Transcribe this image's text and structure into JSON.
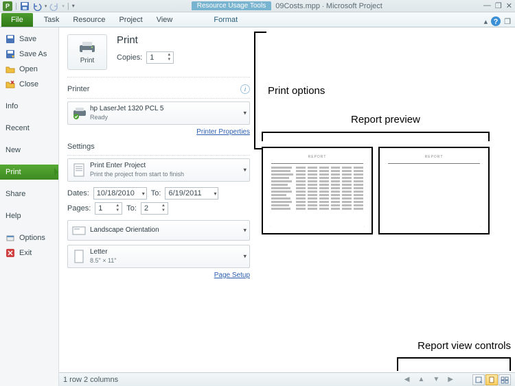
{
  "titlebar": {
    "context_tool_group": "Resource Usage Tools",
    "doc": "09Costs.mpp",
    "app": "Microsoft Project"
  },
  "ribbon": {
    "file": "File",
    "tabs": [
      "Task",
      "Resource",
      "Project",
      "View"
    ],
    "context_tab": "Format"
  },
  "backnav": {
    "save": "Save",
    "save_as": "Save As",
    "open": "Open",
    "close": "Close",
    "info": "Info",
    "recent": "Recent",
    "new": "New",
    "print": "Print",
    "share": "Share",
    "help": "Help",
    "options": "Options",
    "exit": "Exit"
  },
  "print": {
    "heading": "Print",
    "button": "Print",
    "copies_label": "Copies:",
    "copies_value": "1"
  },
  "printer": {
    "heading": "Printer",
    "name": "hp LaserJet 1320 PCL 5",
    "status": "Ready",
    "properties_link": "Printer Properties"
  },
  "settings": {
    "heading": "Settings",
    "scope_title": "Print Enter Project",
    "scope_sub": "Print the project from start to finish",
    "dates_label": "Dates:",
    "date_from": "10/18/2010",
    "to_label": "To:",
    "date_to": "6/19/2011",
    "pages_label": "Pages:",
    "page_from": "1",
    "page_to": "2",
    "orientation": "Landscape Orientation",
    "paper_name": "Letter",
    "paper_size": "8.5\" × 11\"",
    "page_setup_link": "Page Setup"
  },
  "annotations": {
    "print_options": "Print options",
    "report_preview": "Report preview",
    "report_view_controls": "Report view controls"
  },
  "status": {
    "text": "1 row 2 columns"
  }
}
